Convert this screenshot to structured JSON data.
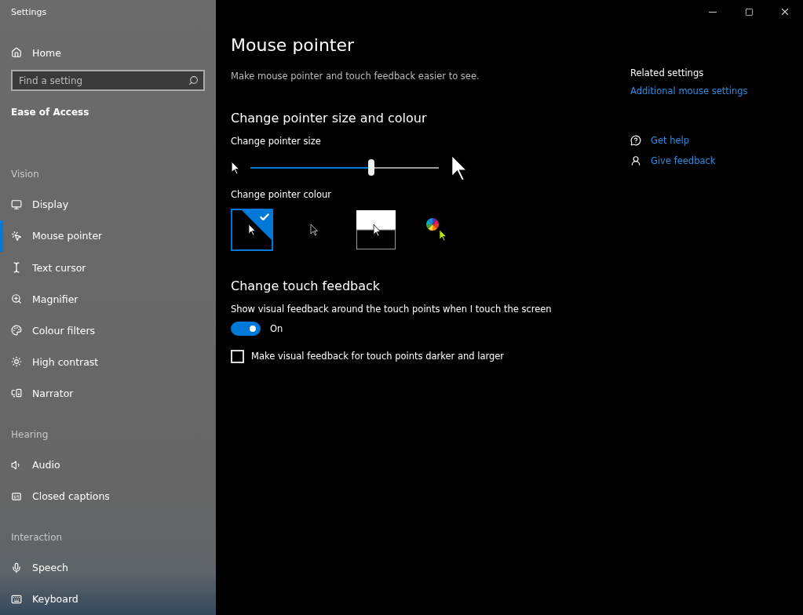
{
  "window": {
    "title": "Settings"
  },
  "sidebar": {
    "home": "Home",
    "search": {
      "placeholder": "Find a setting"
    },
    "category": "Ease of Access",
    "sections": [
      {
        "heading": "Vision",
        "items": [
          {
            "label": "Display",
            "selected": false
          },
          {
            "label": "Mouse pointer",
            "selected": true
          },
          {
            "label": "Text cursor",
            "selected": false
          },
          {
            "label": "Magnifier",
            "selected": false
          },
          {
            "label": "Colour filters",
            "selected": false
          },
          {
            "label": "High contrast",
            "selected": false
          },
          {
            "label": "Narrator",
            "selected": false
          }
        ]
      },
      {
        "heading": "Hearing",
        "items": [
          {
            "label": "Audio",
            "selected": false
          },
          {
            "label": "Closed captions",
            "selected": false
          }
        ]
      },
      {
        "heading": "Interaction",
        "items": [
          {
            "label": "Speech",
            "selected": false
          },
          {
            "label": "Keyboard",
            "selected": false
          }
        ]
      }
    ]
  },
  "page": {
    "title": "Mouse pointer",
    "description": "Make mouse pointer and touch feedback easier to see.",
    "pointer_section": {
      "heading": "Change pointer size and colour",
      "size_label": "Change pointer size",
      "size": {
        "level": 0.64
      },
      "colour_label": "Change pointer colour",
      "colours": [
        {
          "kind": "white",
          "selected": true
        },
        {
          "kind": "black",
          "selected": false
        },
        {
          "kind": "inverted",
          "selected": false
        },
        {
          "kind": "custom",
          "selected": false
        }
      ]
    },
    "touch_section": {
      "heading": "Change touch feedback",
      "toggle_label": "Show visual feedback around the touch points when I touch the screen",
      "toggle": {
        "on": true,
        "state": "On"
      },
      "checkbox": {
        "label": "Make visual feedback for touch points darker and larger",
        "checked": false
      }
    }
  },
  "related": {
    "heading": "Related settings",
    "links": [
      "Additional mouse settings"
    ],
    "help": [
      {
        "kind": "help",
        "label": "Get help"
      },
      {
        "kind": "feedback",
        "label": "Give feedback"
      }
    ]
  }
}
